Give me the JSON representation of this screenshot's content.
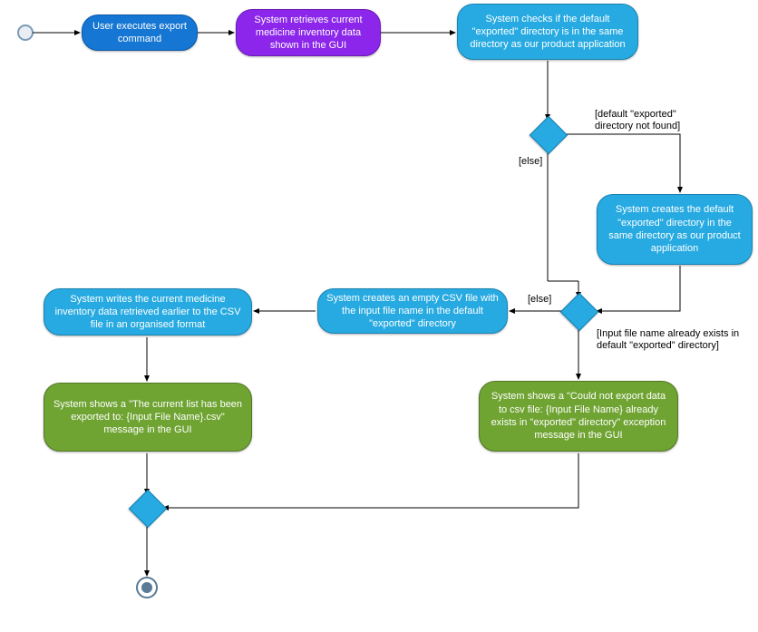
{
  "chart_data": {
    "type": "activity-diagram",
    "nodes": [
      {
        "id": "start",
        "shape": "initial"
      },
      {
        "id": "n1",
        "shape": "action",
        "color": "blue",
        "text": "User executes export command"
      },
      {
        "id": "n2",
        "shape": "action",
        "color": "purple",
        "text": "System retrieves current medicine inventory data shown in the GUI"
      },
      {
        "id": "n3",
        "shape": "action",
        "color": "cyan",
        "text": "System checks if the default \"exported\" directory is in the same directory as our product application"
      },
      {
        "id": "d1",
        "shape": "decision"
      },
      {
        "id": "n4",
        "shape": "action",
        "color": "cyan",
        "text": "System creates the default \"exported\" directory in the same directory as our product application"
      },
      {
        "id": "d2",
        "shape": "decision"
      },
      {
        "id": "n5",
        "shape": "action",
        "color": "cyan",
        "text": "System creates an empty CSV file with the input file name in the default \"exported\" directory"
      },
      {
        "id": "n6",
        "shape": "action",
        "color": "cyan",
        "text": "System writes the current medicine inventory data retrieved earlier to the CSV file in an organised format"
      },
      {
        "id": "n7",
        "shape": "action",
        "color": "green",
        "text": "System shows a \"The current list has been exported to: {Input File Name}.csv\" message in the GUI"
      },
      {
        "id": "n8",
        "shape": "action",
        "color": "green",
        "text": "System shows a \"Could not export data to csv file: {Input File Name} already exists in \"exported\" directory\" exception message in the GUI"
      },
      {
        "id": "d3",
        "shape": "merge"
      },
      {
        "id": "end",
        "shape": "final"
      }
    ],
    "edges": [
      {
        "from": "start",
        "to": "n1"
      },
      {
        "from": "n1",
        "to": "n2"
      },
      {
        "from": "n2",
        "to": "n3"
      },
      {
        "from": "n3",
        "to": "d1"
      },
      {
        "from": "d1",
        "to": "n4",
        "label": "[default \"exported\" directory not found]"
      },
      {
        "from": "d1",
        "to": "d2",
        "label": "[else]"
      },
      {
        "from": "n4",
        "to": "d2"
      },
      {
        "from": "d2",
        "to": "n5",
        "label": "[else]"
      },
      {
        "from": "d2",
        "to": "n8",
        "label": "[Input file name already exists in default \"exported\" directory]"
      },
      {
        "from": "n5",
        "to": "n6"
      },
      {
        "from": "n6",
        "to": "n7"
      },
      {
        "from": "n7",
        "to": "d3"
      },
      {
        "from": "n8",
        "to": "d3"
      },
      {
        "from": "d3",
        "to": "end"
      }
    ]
  },
  "nodes": {
    "n1": "User executes export command",
    "n2": "System retrieves current medicine inventory data shown in the GUI",
    "n3": "System checks if the default \"exported\" directory is in the same directory as our product application",
    "n4": "System creates the default \"exported\" directory in the same directory as our product application",
    "n5": "System creates an empty CSV file with the input file name in the default \"exported\" directory",
    "n6": "System writes the current medicine inventory data retrieved earlier to the CSV file in an organised format",
    "n7": "System shows a \"The current list has been exported to: {Input File Name}.csv\" message in the GUI",
    "n8": "System shows a \"Could not export data to csv file: {Input File Name} already exists in \"exported\" directory\" exception message in the GUI"
  },
  "labels": {
    "l1": "[default \"exported\" directory not found]",
    "l2": "[else]",
    "l3": "[else]",
    "l4": "[Input file name already exists in default \"exported\" directory]"
  }
}
